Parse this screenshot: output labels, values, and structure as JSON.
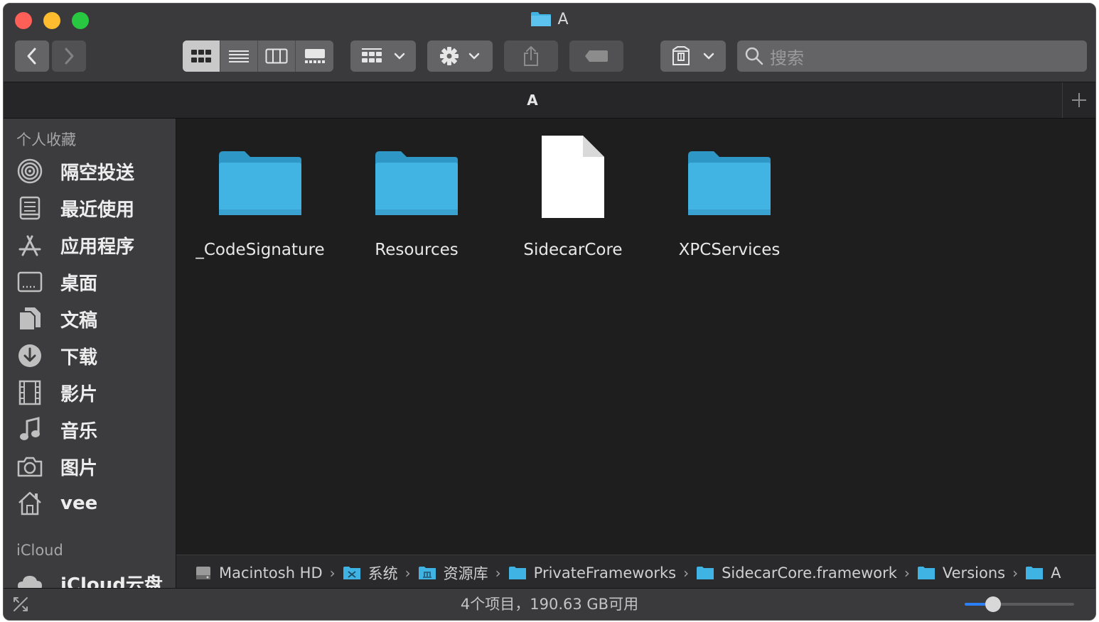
{
  "window": {
    "title": "A"
  },
  "toolbar": {
    "view_modes": [
      "icon-view",
      "list-view",
      "column-view",
      "gallery-view"
    ],
    "active_view": "icon-view",
    "search_placeholder": "搜索"
  },
  "tab": {
    "title": "A"
  },
  "sidebar": {
    "favorites_header": "个人收藏",
    "items": [
      {
        "label": "隔空投送",
        "icon": "airdrop-icon"
      },
      {
        "label": "最近使用",
        "icon": "recents-icon"
      },
      {
        "label": "应用程序",
        "icon": "applications-icon"
      },
      {
        "label": "桌面",
        "icon": "desktop-icon"
      },
      {
        "label": "文稿",
        "icon": "documents-icon"
      },
      {
        "label": "下载",
        "icon": "downloads-icon"
      },
      {
        "label": "影片",
        "icon": "movies-icon"
      },
      {
        "label": "音乐",
        "icon": "music-icon"
      },
      {
        "label": "图片",
        "icon": "pictures-icon"
      },
      {
        "label": "vee",
        "icon": "home-icon"
      }
    ],
    "icloud_header": "iCloud",
    "icloud_items": [
      {
        "label": "iCloud云盘",
        "icon": "icloud-icon"
      }
    ]
  },
  "files": [
    {
      "name": "_CodeSignature",
      "kind": "folder"
    },
    {
      "name": "Resources",
      "kind": "folder"
    },
    {
      "name": "SidecarCore",
      "kind": "file"
    },
    {
      "name": "XPCServices",
      "kind": "folder"
    }
  ],
  "pathbar": [
    {
      "label": "Macintosh HD",
      "icon": "hard-drive-icon"
    },
    {
      "label": "系统",
      "icon": "system-folder-icon"
    },
    {
      "label": "资源库",
      "icon": "library-folder-icon"
    },
    {
      "label": "PrivateFrameworks",
      "icon": "folder-icon"
    },
    {
      "label": "SidecarCore.framework",
      "icon": "folder-icon"
    },
    {
      "label": "Versions",
      "icon": "folder-icon"
    },
    {
      "label": "A",
      "icon": "folder-icon"
    }
  ],
  "status": {
    "text": "4个项目，190.63 GB可用",
    "icon_size_fraction": 0.26
  },
  "colors": {
    "folder": "#3fb3e3",
    "accent": "#2c7ff5"
  }
}
